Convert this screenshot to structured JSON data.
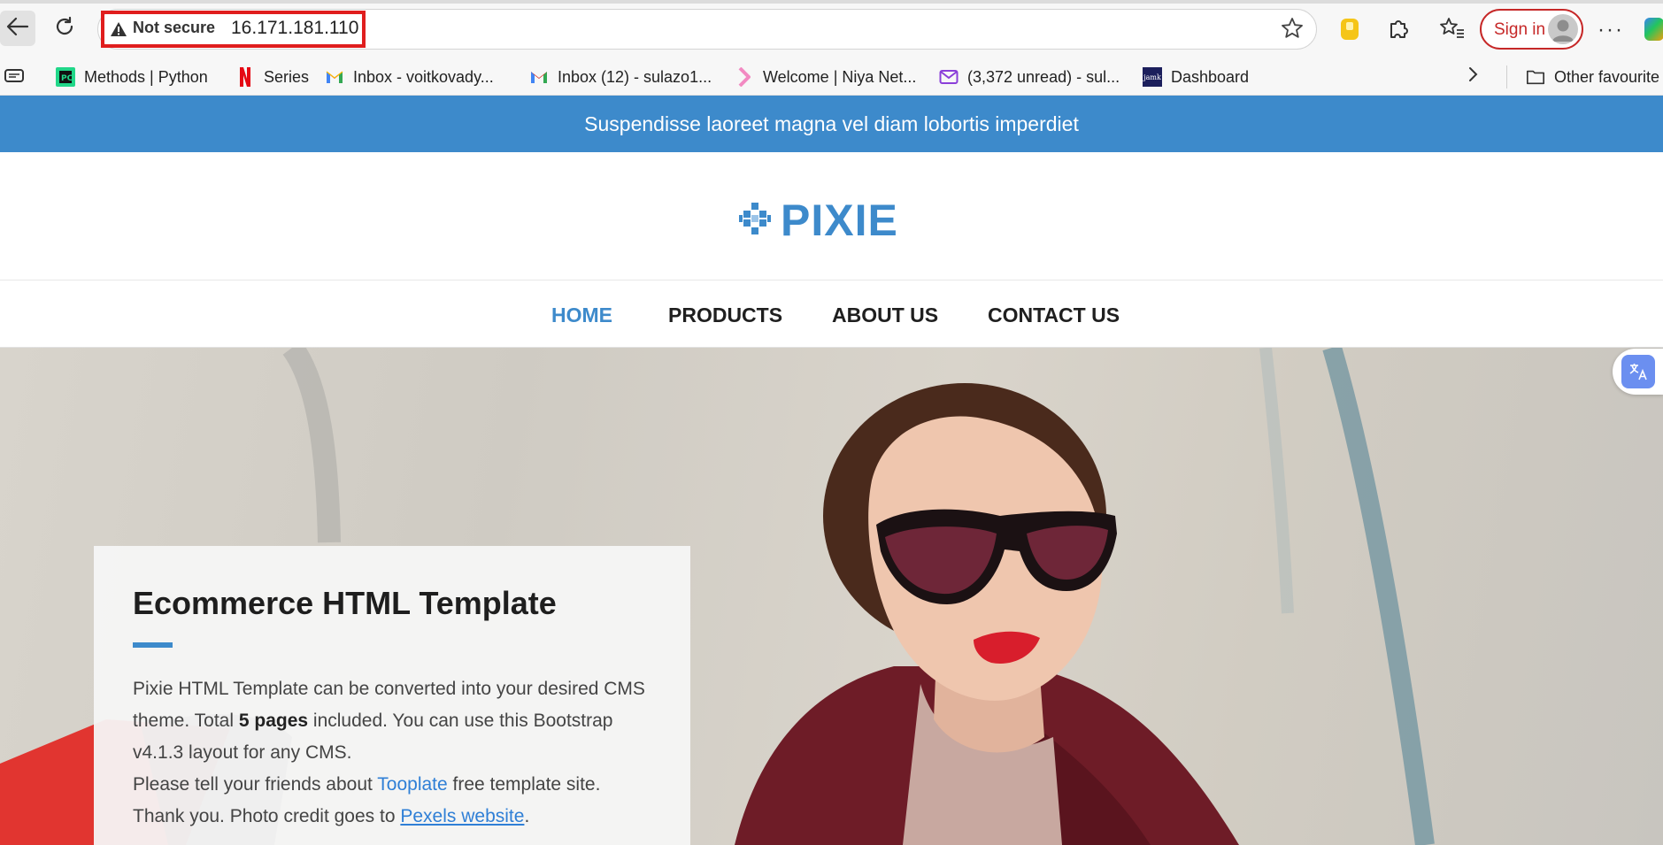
{
  "browser": {
    "security_label": "Not secure",
    "url": "16.171.181.110",
    "sign_in_label": "Sign in",
    "more_label": "···",
    "bookmarks": [
      {
        "label": "Methods | Python",
        "icon": "pycharm-icon"
      },
      {
        "label": "Series",
        "icon": "netflix-icon"
      },
      {
        "label": "Inbox - voitkovady...",
        "icon": "gmail-icon"
      },
      {
        "label": "Inbox (12) - sulazo1...",
        "icon": "gmail-icon"
      },
      {
        "label": "Welcome | Niya Net...",
        "icon": "chevron-brand-icon"
      },
      {
        "label": "(3,372 unread) - sul...",
        "icon": "mail-icon"
      },
      {
        "label": "Dashboard",
        "icon": "jamk-icon"
      }
    ],
    "jamk_icon_text": "jamk",
    "other_favourites": "Other favourite",
    "colors": {
      "security_warning": "#e01e1e",
      "sign_in": "#c62828"
    }
  },
  "site": {
    "announcement": "Suspendisse laoreet magna vel diam lobortis imperdiet",
    "logo_text": "PIXIE",
    "nav": [
      {
        "label": "HOME",
        "active": true
      },
      {
        "label": "PRODUCTS",
        "active": false
      },
      {
        "label": "ABOUT US",
        "active": false
      },
      {
        "label": "CONTACT US",
        "active": false
      }
    ],
    "hero": {
      "title": "Ecommerce HTML Template",
      "p1_a": "Pixie HTML Template can be converted into your desired CMS theme. Total ",
      "p1_bold": "5 pages",
      "p1_b": " included. You can use this Bootstrap v4.1.3 layout for any CMS.",
      "p2_a": "Please tell your friends about ",
      "p2_link": "Tooplate",
      "p2_b": " free template site.",
      "p3_a": "Thank you. Photo credit goes to ",
      "p3_link": "Pexels website",
      "p3_b": "."
    },
    "colors": {
      "brand": "#3d8acb",
      "link": "#2f7fd6",
      "text": "#444444"
    }
  }
}
